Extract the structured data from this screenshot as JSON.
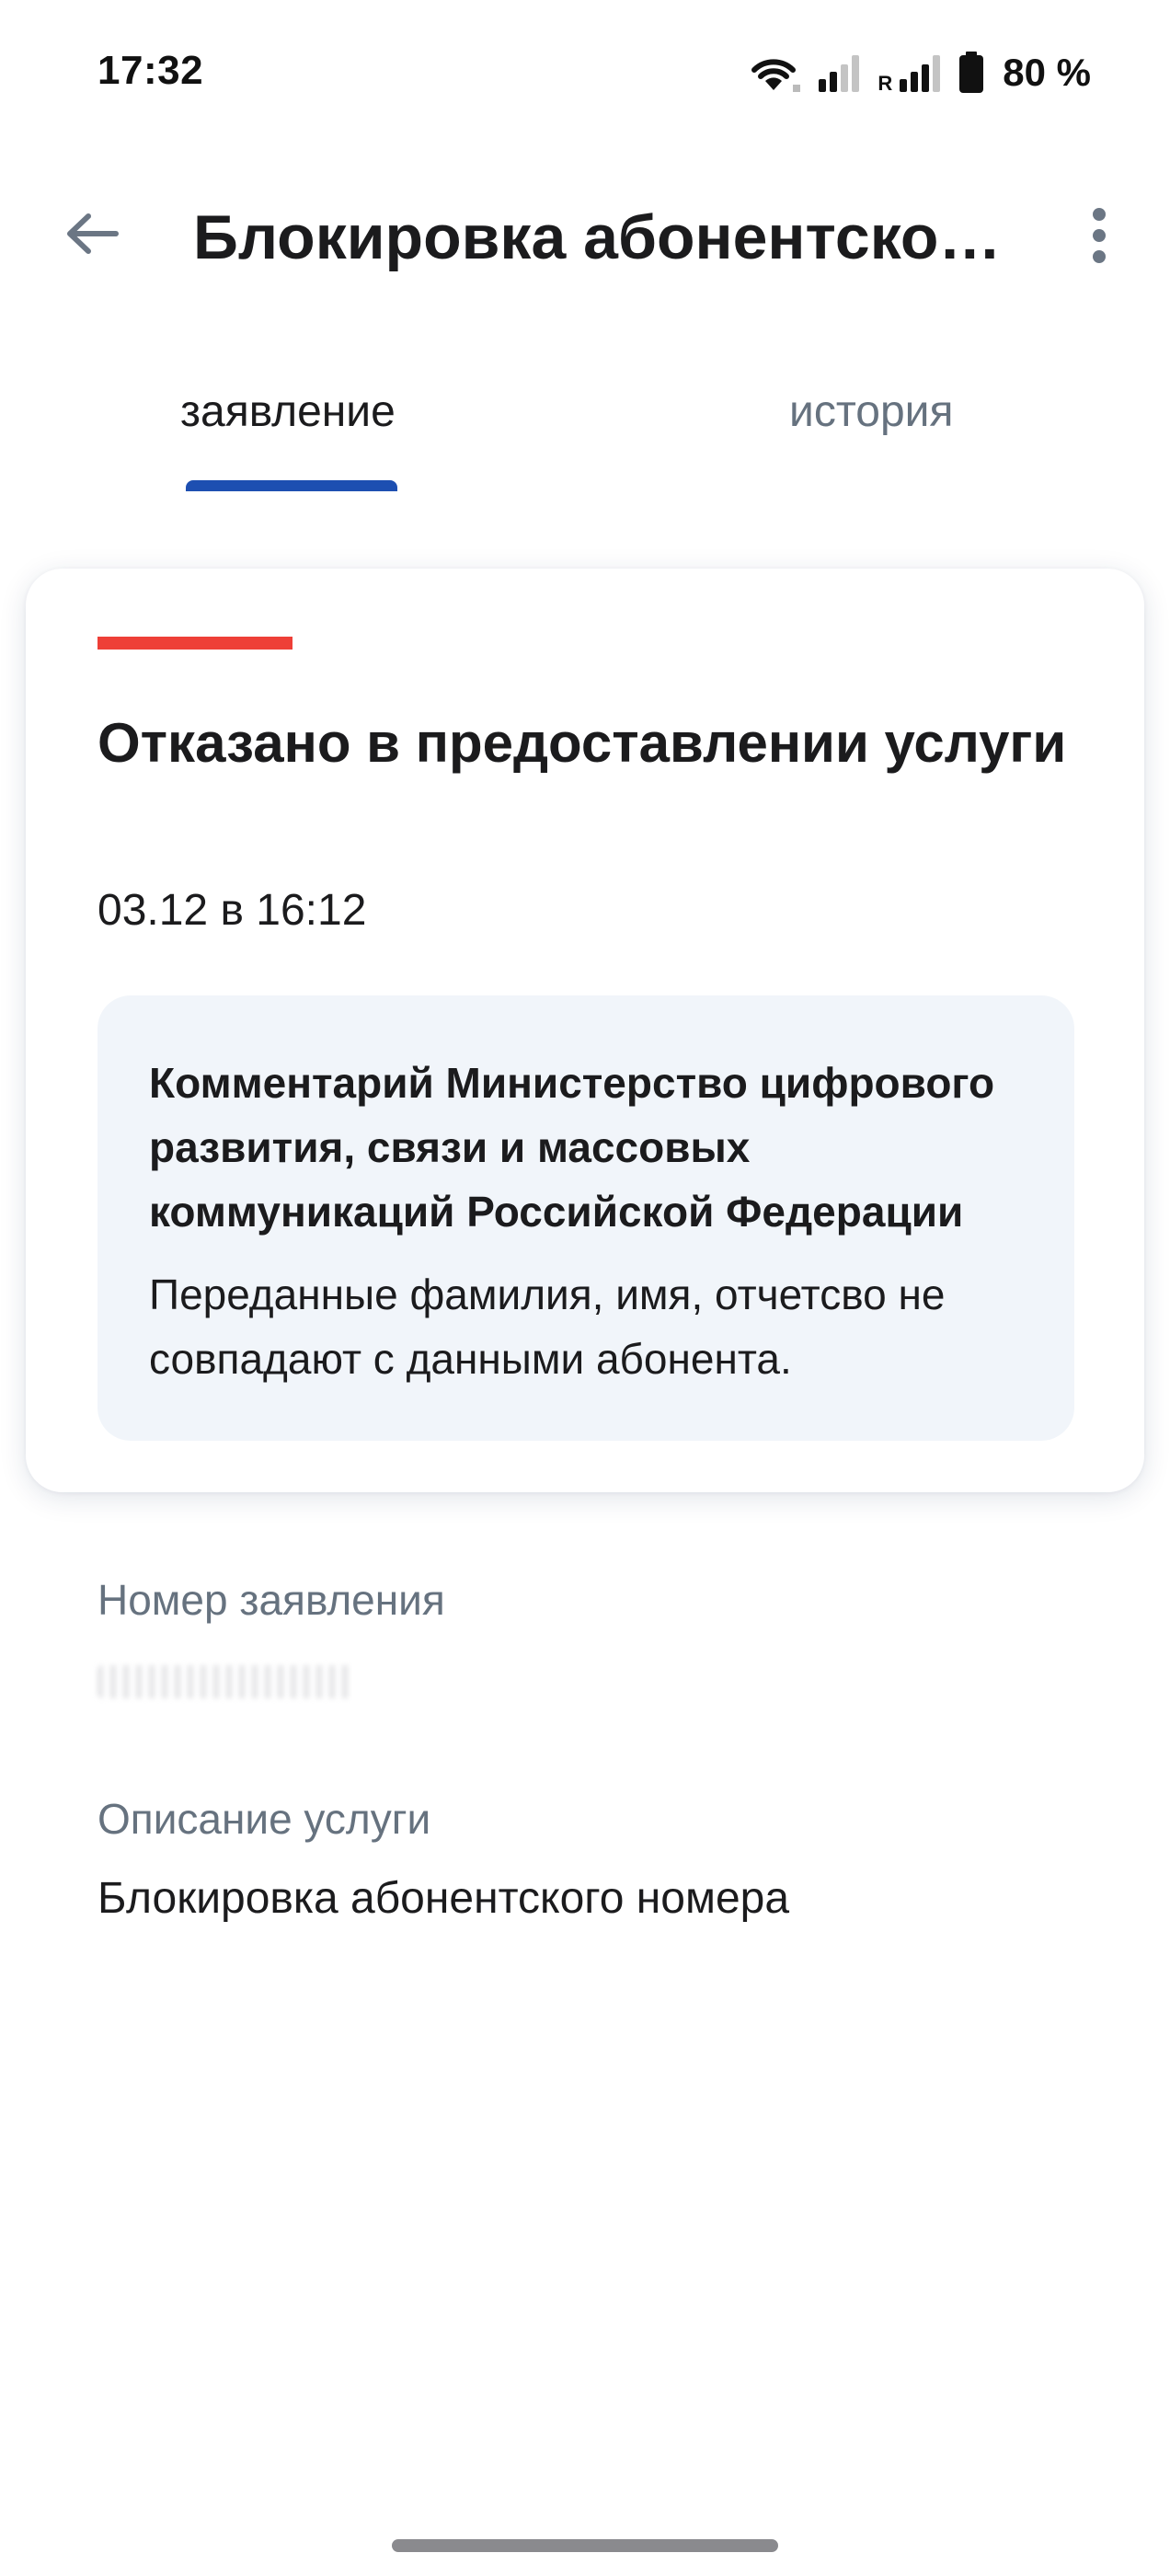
{
  "status_bar": {
    "time": "17:32",
    "battery": "80 %",
    "roaming": "R",
    "icons": [
      "wifi-icon",
      "signal-weak-icon",
      "signal-roaming-icon",
      "battery-icon"
    ]
  },
  "app_bar": {
    "title": "Блокировка абонентског…",
    "back_icon": "arrow-left-icon",
    "more_icon": "more-vertical-icon"
  },
  "tabs": [
    {
      "label": "заявление",
      "active": true
    },
    {
      "label": "история",
      "active": false
    }
  ],
  "status_card": {
    "stripe_color": "#ee3f37",
    "title": "Отказано в предоставлении услуги",
    "date": "03.12 в 16:12",
    "comment": {
      "title": "Комментарий Министерство цифрового развития, связи и массовых коммуникаций Российской Федерации",
      "text": "Переданные фамилия, имя, отчетсво не совпадают с данными абонента."
    }
  },
  "details": {
    "number_label": "Номер заявления",
    "description_label": "Описание услуги",
    "description_value": "Блокировка абонентского номера"
  },
  "colors": {
    "accent": "#1d4fb1",
    "error": "#ee3f37",
    "muted_text": "#66727f",
    "comment_bg": "#f1f5fa"
  }
}
